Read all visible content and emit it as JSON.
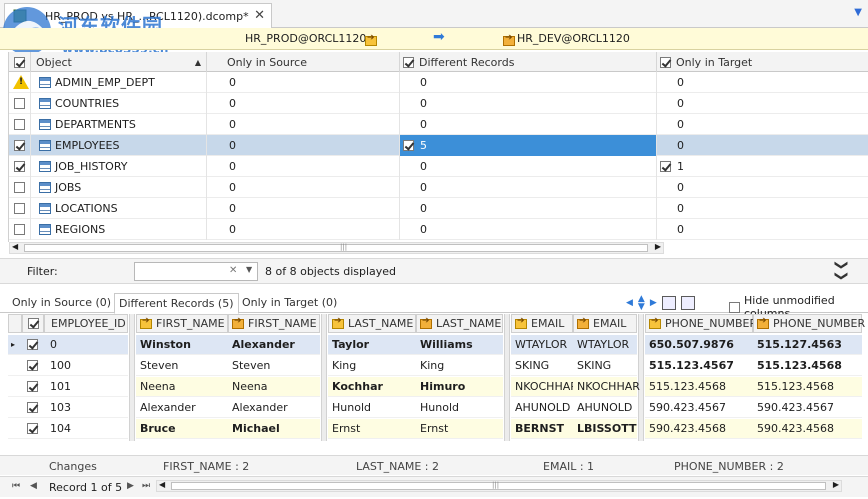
{
  "tab": {
    "title": "HR_PROD vs HR_...RCL1120).dcomp*",
    "close": "✕",
    "menu_arrow": "▼"
  },
  "watermark": {
    "title": "河东软件园",
    "url": "www.pc0359.cn"
  },
  "connection": {
    "source": "HR_PROD@ORCL1120",
    "target": "HR_DEV@ORCL1120"
  },
  "objects": {
    "columns": [
      "Object",
      "Only in Source",
      "Different Records",
      "Only in Target"
    ],
    "sort_indicator": "▲",
    "rows": [
      {
        "name": "ADMIN_EMP_DEPT",
        "only_source": "0",
        "different": "0",
        "only_target": "0",
        "warning": true
      },
      {
        "name": "COUNTRIES",
        "only_source": "0",
        "different": "0",
        "only_target": "0"
      },
      {
        "name": "DEPARTMENTS",
        "only_source": "0",
        "different": "0",
        "only_target": "0"
      },
      {
        "name": "EMPLOYEES",
        "only_source": "0",
        "different": "5",
        "only_target": "0",
        "selected": true
      },
      {
        "name": "JOB_HISTORY",
        "only_source": "0",
        "different": "0",
        "only_target": "1"
      },
      {
        "name": "JOBS",
        "only_source": "0",
        "different": "0",
        "only_target": "0"
      },
      {
        "name": "LOCATIONS",
        "only_source": "0",
        "different": "0",
        "only_target": "0"
      },
      {
        "name": "REGIONS",
        "only_source": "0",
        "different": "0",
        "only_target": "0"
      }
    ]
  },
  "filter": {
    "label": "Filter:",
    "value": "",
    "clear": "✕",
    "dropdown": "▼",
    "count_text": "8 of 8 objects displayed",
    "collapse": "❯❯"
  },
  "detail_tabs": [
    "Only in Source (0)",
    "Different Records (5)",
    "Only in Target (0)"
  ],
  "hide_unmodified": {
    "label": "Hide unmodified columns",
    "checked": false
  },
  "records": {
    "key_column": "EMPLOYEE_ID",
    "pairs": [
      {
        "source_header": "FIRST_NAME",
        "target_header": "FIRST_NAME"
      },
      {
        "source_header": "LAST_NAME",
        "target_header": "LAST_NAME"
      },
      {
        "source_header": "EMAIL",
        "target_header": "EMAIL"
      },
      {
        "source_header": "PHONE_NUMBER",
        "target_header": "PHONE_NUMBER"
      }
    ],
    "rows": [
      {
        "id": "0",
        "first_s": "Winston",
        "first_t": "Alexander",
        "last_s": "Taylor",
        "last_t": "Williams",
        "email_s": "WTAYLOR",
        "email_t": "WTAYLOR",
        "phone_s": "650.507.9876",
        "phone_t": "515.127.4563"
      },
      {
        "id": "100",
        "first_s": "Steven",
        "first_t": "Steven",
        "last_s": "King",
        "last_t": "King",
        "email_s": "SKING",
        "email_t": "SKING",
        "phone_s": "515.123.4567",
        "phone_t": "515.123.4568"
      },
      {
        "id": "101",
        "first_s": "Neena",
        "first_t": "Neena",
        "last_s": "Kochhar",
        "last_t": "Himuro",
        "email_s": "NKOCHHAR",
        "email_t": "NKOCHHAR",
        "phone_s": "515.123.4568",
        "phone_t": "515.123.4568"
      },
      {
        "id": "103",
        "first_s": "Alexander",
        "first_t": "Alexander",
        "last_s": "Hunold",
        "last_t": "Hunold",
        "email_s": "AHUNOLD",
        "email_t": "AHUNOLD",
        "phone_s": "590.423.4567",
        "phone_t": "590.423.4567"
      },
      {
        "id": "104",
        "first_s": "Bruce",
        "first_t": "Michael",
        "last_s": "Ernst",
        "last_t": "Ernst",
        "email_s": "BERNST",
        "email_t": "LBISSOTT",
        "phone_s": "590.423.4568",
        "phone_t": "590.423.4568"
      }
    ],
    "current_row_marker": "▸"
  },
  "changes": {
    "label": "Changes",
    "first_name": "FIRST_NAME : 2",
    "last_name": "LAST_NAME : 2",
    "email": "EMAIL : 1",
    "phone_number": "PHONE_NUMBER : 2"
  },
  "navigator": {
    "first": "⏮",
    "prev": "◀",
    "text": "Record 1 of 5",
    "next": "▶",
    "last": "⏭",
    "scroll_left": "◀",
    "scroll_right": "▶",
    "scroll_grip": "|||"
  },
  "colors": {
    "accent": "#3c8fd8",
    "selection": "#c7d8ea",
    "changed_cell": "#fefde2",
    "header_bar": "#fffbd8"
  }
}
